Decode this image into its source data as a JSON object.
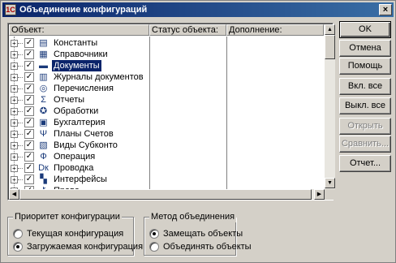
{
  "window": {
    "title": "Объединение конфигураций",
    "close_label": "×",
    "app_icon": "1c-icon"
  },
  "columns": [
    "Объект:",
    "Статус объекта:",
    "Дополнение:"
  ],
  "tree": {
    "items": [
      {
        "label": "Константы",
        "checked": true,
        "icon": "constants-icon",
        "glyph": "▤",
        "selected": false
      },
      {
        "label": "Справочники",
        "checked": true,
        "icon": "catalog-icon",
        "glyph": "▦",
        "selected": false
      },
      {
        "label": "Документы",
        "checked": true,
        "icon": "folder-icon",
        "glyph": "▬",
        "selected": true
      },
      {
        "label": "Журналы документов",
        "checked": true,
        "icon": "journal-icon",
        "glyph": "▥",
        "selected": false
      },
      {
        "label": "Перечисления",
        "checked": true,
        "icon": "enum-icon",
        "glyph": "◎",
        "selected": false
      },
      {
        "label": "Отчеты",
        "checked": true,
        "icon": "report-icon",
        "glyph": "Σ",
        "selected": false
      },
      {
        "label": "Обработки",
        "checked": true,
        "icon": "processing-icon",
        "glyph": "✪",
        "selected": false
      },
      {
        "label": "Бухгалтерия",
        "checked": true,
        "icon": "accounting-icon",
        "glyph": "▣",
        "selected": false
      },
      {
        "label": "Планы Счетов",
        "checked": true,
        "icon": "chart-of-accounts-icon",
        "glyph": "Ψ",
        "selected": false
      },
      {
        "label": "Виды Субконто",
        "checked": true,
        "icon": "subconto-icon",
        "glyph": "▧",
        "selected": false
      },
      {
        "label": "Операция",
        "checked": true,
        "icon": "operation-icon",
        "glyph": "Ф",
        "selected": false
      },
      {
        "label": "Проводка",
        "checked": true,
        "icon": "posting-icon",
        "glyph": "Dк",
        "selected": false
      },
      {
        "label": "Интерфейсы",
        "checked": true,
        "icon": "interface-icon",
        "glyph": "▚",
        "selected": false
      },
      {
        "label": "Права",
        "checked": true,
        "icon": "rights-icon",
        "glyph": "⚷",
        "selected": false
      }
    ],
    "expander_symbol": "+",
    "check_symbol": "✓"
  },
  "scrollbars": {
    "up": "▲",
    "down": "▼",
    "left": "◀",
    "right": "▶"
  },
  "buttons": {
    "ok": "OK",
    "cancel": "Отмена",
    "help": "Помощь",
    "enable_all": "Вкл. все",
    "disable_all": "Выкл. все",
    "open": "Открыть",
    "compare": "Сравнить...",
    "report": "Отчет..."
  },
  "priority_group": {
    "title": "Приоритет конфигурации",
    "options": [
      {
        "label": "Текущая конфигурация",
        "selected": false
      },
      {
        "label": "Загружаемая конфигурация",
        "selected": true
      }
    ]
  },
  "merge_group": {
    "title": "Метод объединения",
    "options": [
      {
        "label": "Замещать объекты",
        "selected": true
      },
      {
        "label": "Объединять объекты",
        "selected": false
      }
    ]
  }
}
